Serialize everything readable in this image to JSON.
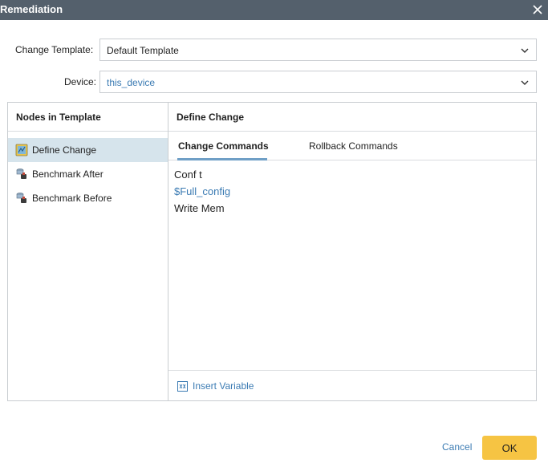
{
  "window": {
    "title": "Remediation"
  },
  "form": {
    "change_template_label": "Change Template:",
    "change_template_value": "Default Template",
    "device_label": "Device:",
    "device_value": "this_device"
  },
  "nodes_panel": {
    "heading": "Nodes in Template",
    "items": [
      {
        "label": "Define Change",
        "icon": "define-change-icon",
        "selected": true
      },
      {
        "label": "Benchmark After",
        "icon": "benchmark-icon",
        "selected": false
      },
      {
        "label": "Benchmark Before",
        "icon": "benchmark-icon",
        "selected": false
      }
    ]
  },
  "detail_panel": {
    "heading": "Define Change",
    "tabs": [
      {
        "label": "Change Commands",
        "active": true
      },
      {
        "label": "Rollback Commands",
        "active": false
      }
    ],
    "commands": [
      {
        "text": "Conf t",
        "is_variable": false
      },
      {
        "text": "$Full_config",
        "is_variable": true
      },
      {
        "text": "Write Mem",
        "is_variable": false
      }
    ],
    "insert_variable_label": "Insert Variable"
  },
  "buttons": {
    "cancel": "Cancel",
    "ok": "OK"
  },
  "colors": {
    "titlebar": "#54606c",
    "selected_node": "#d6e4ec",
    "link": "#3b7bb3",
    "ok_button": "#f6c443",
    "tab_underline": "#6f9fc6"
  }
}
